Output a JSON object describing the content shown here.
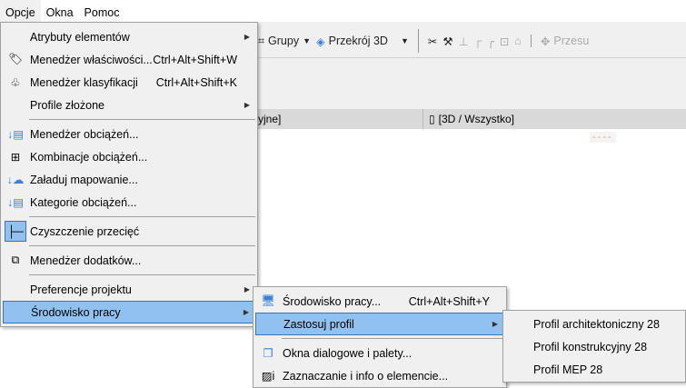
{
  "menubar": {
    "items": [
      "Opcje",
      "Okna",
      "Pomoc"
    ]
  },
  "toolbar": {
    "groups": "Grupy",
    "section3d": "Przekrój 3D",
    "move": "Przesu"
  },
  "tabs": {
    "left": "yjne]",
    "right": "[3D / Wszystko]"
  },
  "indicator": "----",
  "main_menu": {
    "items": [
      {
        "label": "Atrybuty elementów",
        "submenu": true
      },
      {
        "label": "Menedżer właściwości...",
        "shortcut": "Ctrl+Alt+Shift+W",
        "icon": "tag-icon"
      },
      {
        "label": "Menedżer klasyfikacji",
        "shortcut": "Ctrl+Alt+Shift+K",
        "icon": "tree-icon"
      },
      {
        "label": "Profile złożone",
        "submenu": true
      },
      {
        "label": "Menedżer obciążeń...",
        "icon": "load-manager-icon"
      },
      {
        "label": "Kombinacje obciążeń...",
        "icon": "load-combination-icon"
      },
      {
        "label": "Załaduj mapowanie...",
        "icon": "load-mapping-icon"
      },
      {
        "label": "Kategorie obciążeń...",
        "icon": "load-category-icon"
      },
      {
        "label": "Czyszczenie przecięć",
        "icon": "intersection-cleanup-icon"
      },
      {
        "label": "Menedżer dodatków...",
        "icon": "puzzle-icon"
      },
      {
        "label": "Preferencje projektu",
        "submenu": true
      },
      {
        "label": "Środowisko pracy",
        "submenu": true
      }
    ]
  },
  "work_menu": {
    "items": [
      {
        "label": "Środowisko pracy...",
        "shortcut": "Ctrl+Alt+Shift+Y",
        "icon": "monitor-gear-icon"
      },
      {
        "label": "Zastosuj profil",
        "submenu": true
      },
      {
        "label": "Okna dialogowe i palety...",
        "icon": "windows-icon"
      },
      {
        "label": "Zaznaczanie i info o elemencie...",
        "icon": "selection-info-icon"
      }
    ]
  },
  "profile_menu": {
    "items": [
      "Profil architektoniczny 28",
      "Profil konstrukcyjny 28",
      "Profil MEP 28"
    ]
  }
}
